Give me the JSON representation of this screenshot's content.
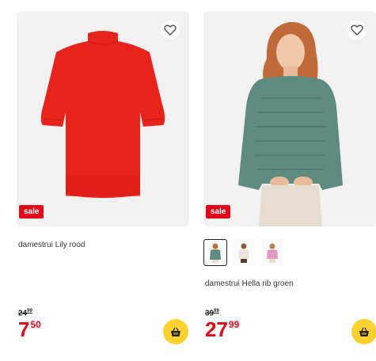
{
  "products": [
    {
      "title": "damestrui Lily rood",
      "badge": "sale",
      "old_price_main": "24",
      "old_price_frac": "99",
      "price_main": "7",
      "price_frac": "50"
    },
    {
      "title": "damestrui Hella rib groen",
      "badge": "sale",
      "old_price_main": "39",
      "old_price_frac": "99",
      "price_main": "27",
      "price_frac": "99",
      "swatches": [
        "green",
        "white",
        "pink"
      ]
    }
  ],
  "colors": {
    "sale": "#e3061b",
    "cart": "#ffd12e",
    "sweater_red": "#e8231c",
    "sweater_green": "#5f8a7f"
  },
  "icons": {
    "favorite": "heart-outline-icon",
    "cart": "shopping-basket-icon"
  }
}
